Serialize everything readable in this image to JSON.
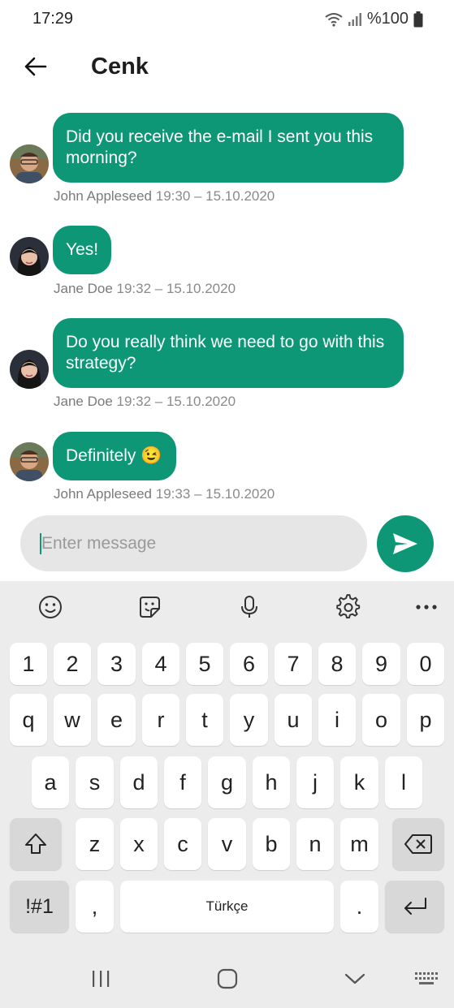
{
  "status": {
    "time": "17:29",
    "battery": "%100"
  },
  "header": {
    "title": "Cenk"
  },
  "messages": [
    {
      "text": "Did you receive the e-mail I sent you this morning?",
      "author": "John Appleseed",
      "time": "19:30 – 15.10.2020",
      "avatar": "john"
    },
    {
      "text": "Yes!",
      "author": "Jane Doe",
      "time": "19:32 – 15.10.2020",
      "avatar": "jane"
    },
    {
      "text": "Do you really think we need to go with this strategy?",
      "author": "Jane Doe",
      "time": "19:32 – 15.10.2020",
      "avatar": "jane"
    },
    {
      "text": "Definitely 😉",
      "author": "John Appleseed",
      "time": "19:33 – 15.10.2020",
      "avatar": "john"
    }
  ],
  "composer": {
    "placeholder": "Enter message"
  },
  "keyboard": {
    "toolbar_icons": [
      "emoji-icon",
      "sticker-icon",
      "microphone-icon",
      "settings-icon",
      "more-icon"
    ],
    "row_numbers": [
      "1",
      "2",
      "3",
      "4",
      "5",
      "6",
      "7",
      "8",
      "9",
      "0"
    ],
    "row1": [
      "q",
      "w",
      "e",
      "r",
      "t",
      "y",
      "u",
      "i",
      "o",
      "p"
    ],
    "row2": [
      "a",
      "s",
      "d",
      "f",
      "g",
      "h",
      "j",
      "k",
      "l"
    ],
    "row3": [
      "z",
      "x",
      "c",
      "v",
      "b",
      "n",
      "m"
    ],
    "symbols_label": "!#1",
    "comma": ",",
    "space_label": "Türkçe",
    "period": "."
  },
  "colors": {
    "accent": "#0e9777",
    "keyboard_bg": "#ececec"
  }
}
